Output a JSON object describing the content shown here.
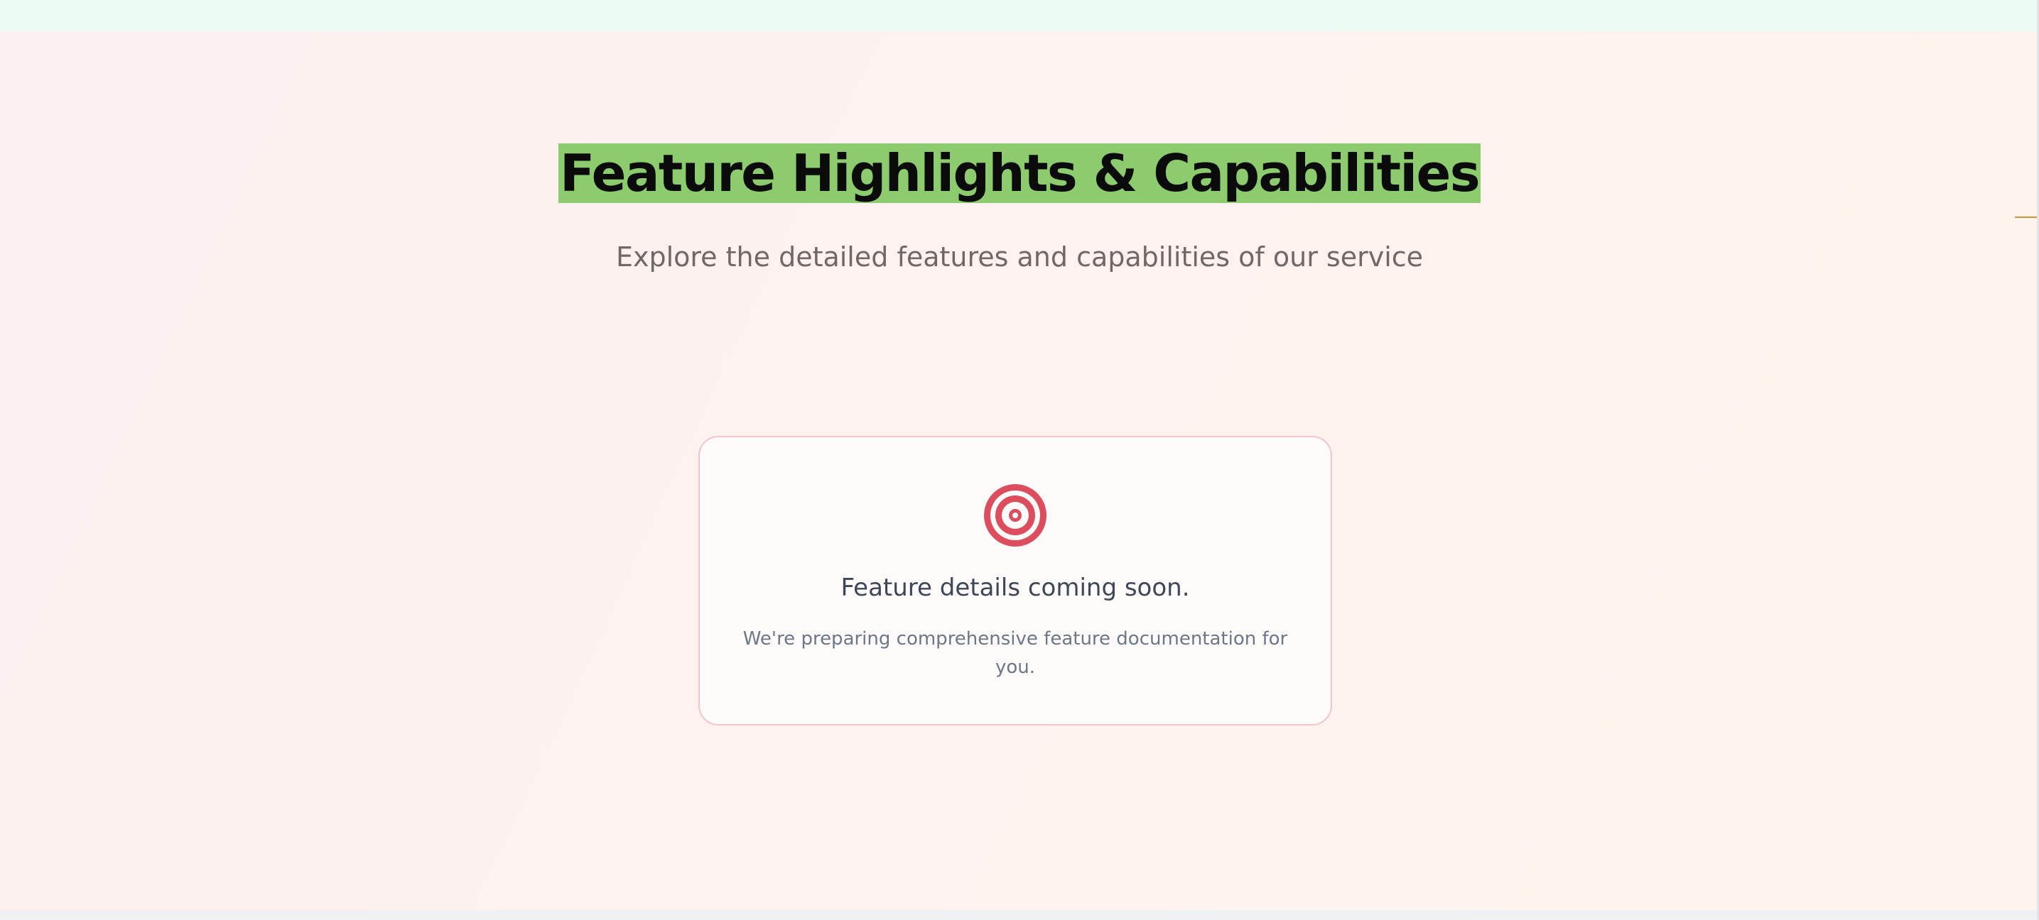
{
  "hero": {
    "title": "Feature Highlights & Capabilities",
    "subtitle": "Explore the detailed features and capabilities of our service"
  },
  "notice_card": {
    "icon": "target-icon",
    "heading": "Feature details coming soon.",
    "message": "We're preparing comprehensive feature documentation for you."
  },
  "colors": {
    "title_highlight": "#8dcb6f",
    "icon_accent": "#dc4d5e",
    "card_border": "#f6c3cb",
    "top_band": "#ecfbf4"
  }
}
